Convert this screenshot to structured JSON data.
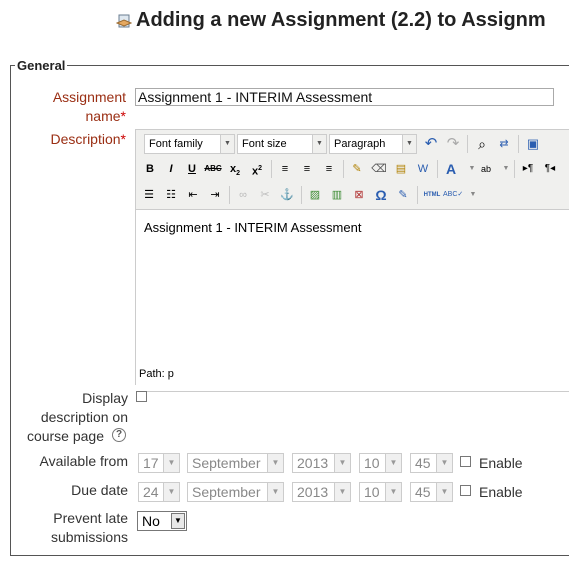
{
  "header": {
    "title": "Adding a new Assignment (2.2) to Assignm"
  },
  "section": {
    "legend": "General"
  },
  "assignment_name": {
    "label": "Assignment",
    "label2": "name",
    "value": "Assignment 1 - INTERIM Assessment"
  },
  "description": {
    "label": "Description",
    "toolbar": {
      "font_family": "Font family",
      "font_size": "Font size",
      "format": "Paragraph"
    },
    "content": "Assignment 1 - INTERIM Assessment",
    "status": "Path: p"
  },
  "display_desc": {
    "l1": "Display",
    "l2": "description on",
    "l3": "course page"
  },
  "available_from": {
    "label": "Available from",
    "day": "17",
    "month": "September",
    "year": "2013",
    "hour": "10",
    "minute": "45",
    "enable": "Enable"
  },
  "due_date": {
    "label": "Due date",
    "day": "24",
    "month": "September",
    "year": "2013",
    "hour": "10",
    "minute": "45",
    "enable": "Enable"
  },
  "prevent_late": {
    "l1": "Prevent late",
    "l2": "submissions",
    "value": "No"
  }
}
